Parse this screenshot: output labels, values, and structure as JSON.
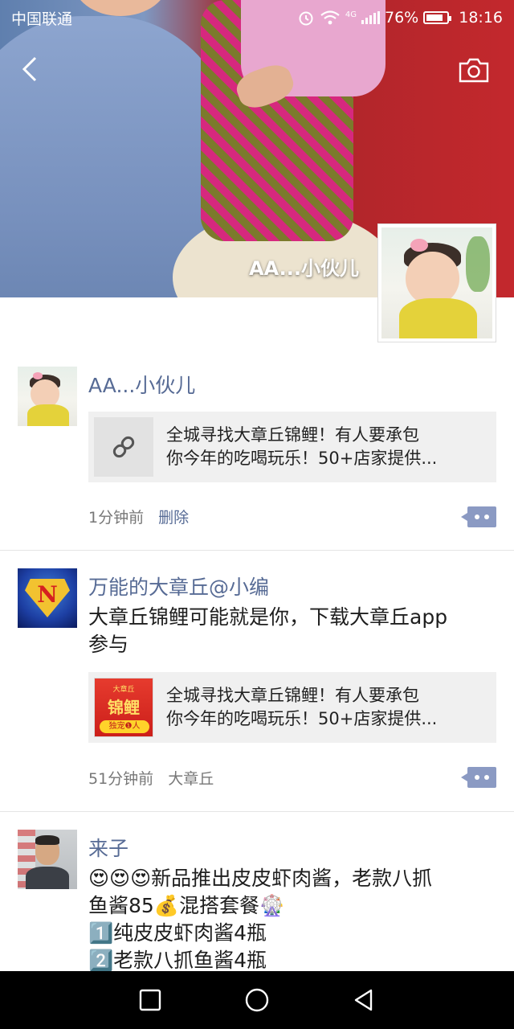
{
  "status_bar": {
    "carrier": "中国联通",
    "network": "4G",
    "battery": "76%",
    "time": "18:16"
  },
  "header": {
    "back_icon": "chevron-left-icon",
    "camera_icon": "camera-icon"
  },
  "profile": {
    "name": "AA...小伙儿"
  },
  "posts": [
    {
      "username": "AA...小伙儿",
      "text": "",
      "link": {
        "line1": "全城寻找大章丘锦鲤！有人要承包",
        "line2": "你今年的吃喝玩乐！50+店家提供..."
      },
      "time": "1分钟前",
      "action": "删除"
    },
    {
      "username": "万能的大章丘@小编",
      "text_line1": "大章丘锦鲤可能就是你，下载大章丘app",
      "text_line2": "参与",
      "link": {
        "line1": "全城寻找大章丘锦鲤！有人要承包",
        "line2": "你今年的吃喝玩乐！50+店家提供...",
        "thumb_top": "大章丘",
        "thumb_main": "锦鲤",
        "thumb_badge": "独宠❶人"
      },
      "time": "51分钟前",
      "source": "大章丘"
    },
    {
      "username": "来子",
      "line1": "😍😍😍新品推出皮皮虾肉酱，老款八抓",
      "line2": "鱼酱85💰混搭套餐🎡",
      "line3": "1️⃣纯皮皮虾肉酱4瓶",
      "line4": "2️⃣老款八抓鱼酱4瓶"
    }
  ],
  "nav": {
    "recent": "square-icon",
    "home": "circle-icon",
    "back": "triangle-back-icon"
  }
}
